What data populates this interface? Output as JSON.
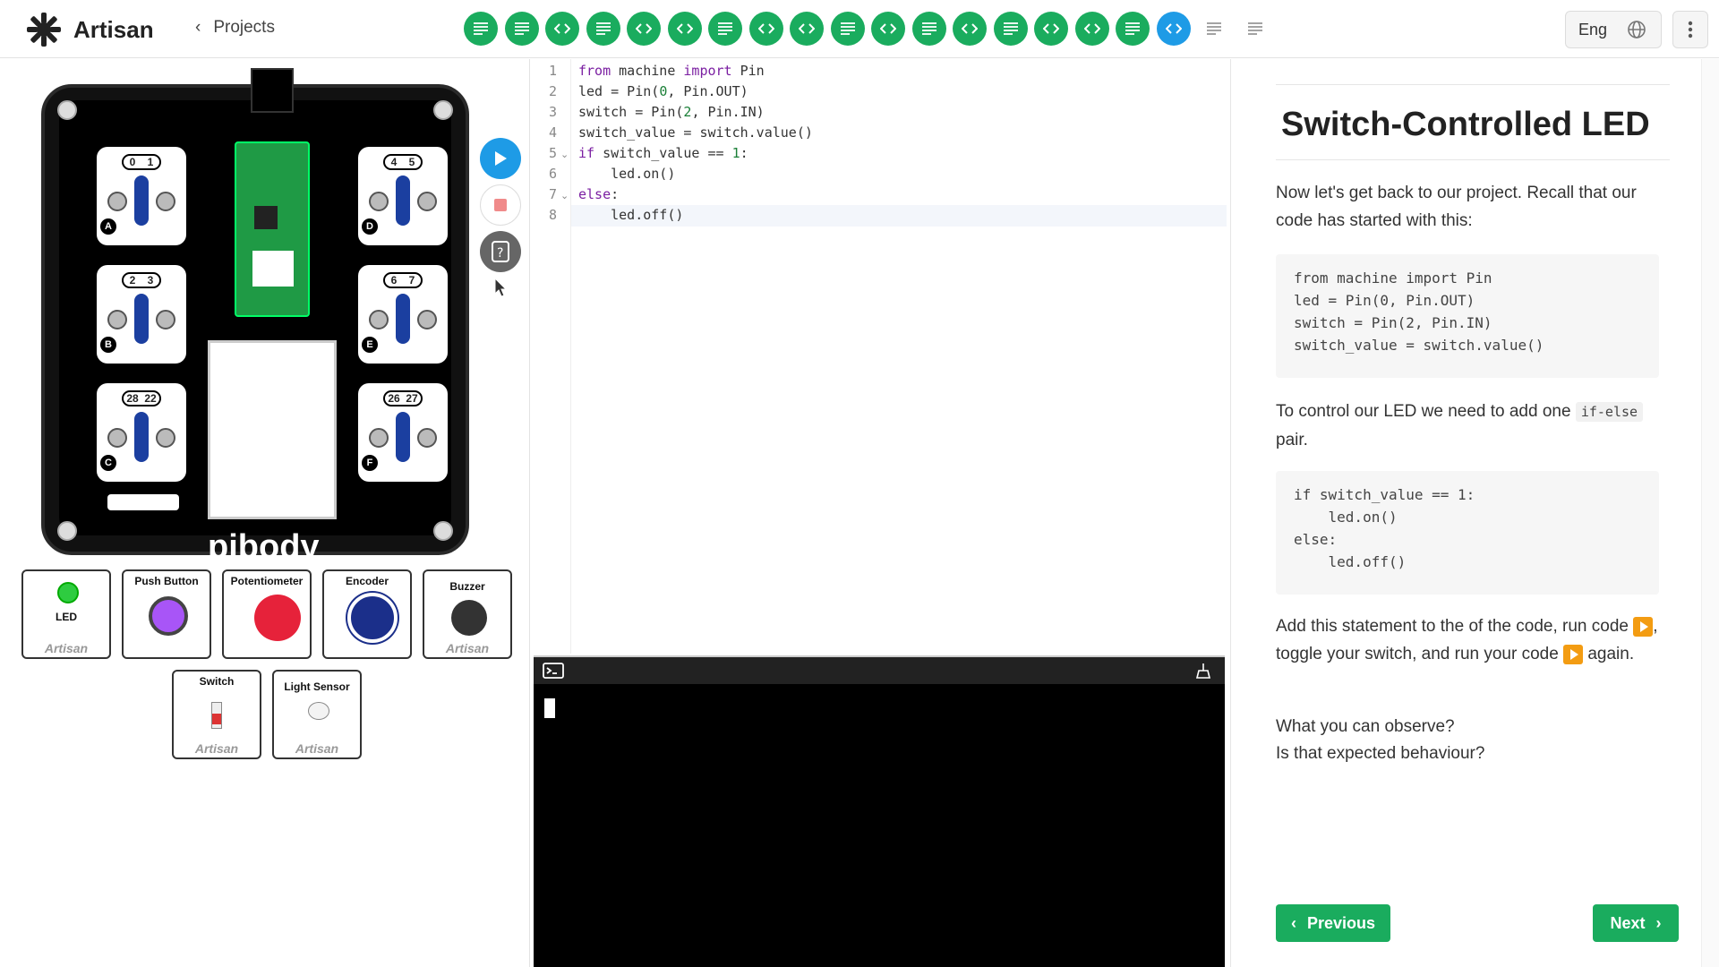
{
  "app": {
    "name": "Artisan",
    "back_label": "Projects"
  },
  "steps": [
    {
      "type": "text",
      "state": "done"
    },
    {
      "type": "text",
      "state": "done"
    },
    {
      "type": "code",
      "state": "done"
    },
    {
      "type": "text",
      "state": "done"
    },
    {
      "type": "code",
      "state": "done"
    },
    {
      "type": "code",
      "state": "done"
    },
    {
      "type": "text",
      "state": "done"
    },
    {
      "type": "code",
      "state": "done"
    },
    {
      "type": "code",
      "state": "done"
    },
    {
      "type": "text",
      "state": "done"
    },
    {
      "type": "code",
      "state": "done"
    },
    {
      "type": "text",
      "state": "done"
    },
    {
      "type": "code",
      "state": "done"
    },
    {
      "type": "text",
      "state": "done"
    },
    {
      "type": "code",
      "state": "done"
    },
    {
      "type": "code",
      "state": "done"
    },
    {
      "type": "text",
      "state": "done"
    },
    {
      "type": "code",
      "state": "active"
    },
    {
      "type": "text",
      "state": "pending"
    },
    {
      "type": "text",
      "state": "pending"
    }
  ],
  "language": {
    "label": "Eng"
  },
  "board": {
    "brand": "pibody",
    "ports": [
      {
        "pins": [
          "0",
          "1"
        ],
        "letter": "A"
      },
      {
        "pins": [
          "2",
          "3"
        ],
        "letter": "B"
      },
      {
        "pins": [
          "28",
          "22"
        ],
        "letter": "C"
      },
      {
        "pins": [
          "4",
          "5"
        ],
        "letter": "D"
      },
      {
        "pins": [
          "6",
          "7"
        ],
        "letter": "E"
      },
      {
        "pins": [
          "26",
          "27"
        ],
        "letter": "F"
      }
    ]
  },
  "components": [
    {
      "label": "LED"
    },
    {
      "label": "Push Button"
    },
    {
      "label": "Potentiometer"
    },
    {
      "label": "Encoder"
    },
    {
      "label": "Buzzer"
    },
    {
      "label": "Switch"
    },
    {
      "label": "Light Sensor"
    }
  ],
  "component_brand": "Artisan",
  "editor": {
    "lines": [
      "from machine import Pin",
      "led = Pin(0, Pin.OUT)",
      "switch = Pin(2, Pin.IN)",
      "switch_value = switch.value()",
      "if switch_value == 1:",
      "    led.on()",
      "else:",
      "    led.off()"
    ],
    "line_numbers": [
      "1",
      "2",
      "3",
      "4",
      "5",
      "6",
      "7",
      "8"
    ]
  },
  "lesson": {
    "title": "Switch-Controlled LED",
    "p1": "Now let's get back to our project. Recall that our code has started with this:",
    "code1": "from machine import Pin\nled = Pin(0, Pin.OUT)\nswitch = Pin(2, Pin.IN)\nswitch_value = switch.value()",
    "p2_before": "To control our LED we need to add one ",
    "p2_code": "if-else",
    "p2_after": " pair.",
    "code2": "if switch_value == 1:\n    led.on()\nelse:\n    led.off()",
    "p3_a": "Add this statement to the of the code, run code ",
    "p3_b": ", toggle your switch, and run your code ",
    "p3_c": " again.",
    "p4": "What you can observe?",
    "p5": "Is that expected behaviour?",
    "prev_label": "Previous",
    "next_label": "Next"
  },
  "colors": {
    "green": "#1aac5e",
    "blue": "#1e9be6",
    "orange": "#f39c12"
  }
}
